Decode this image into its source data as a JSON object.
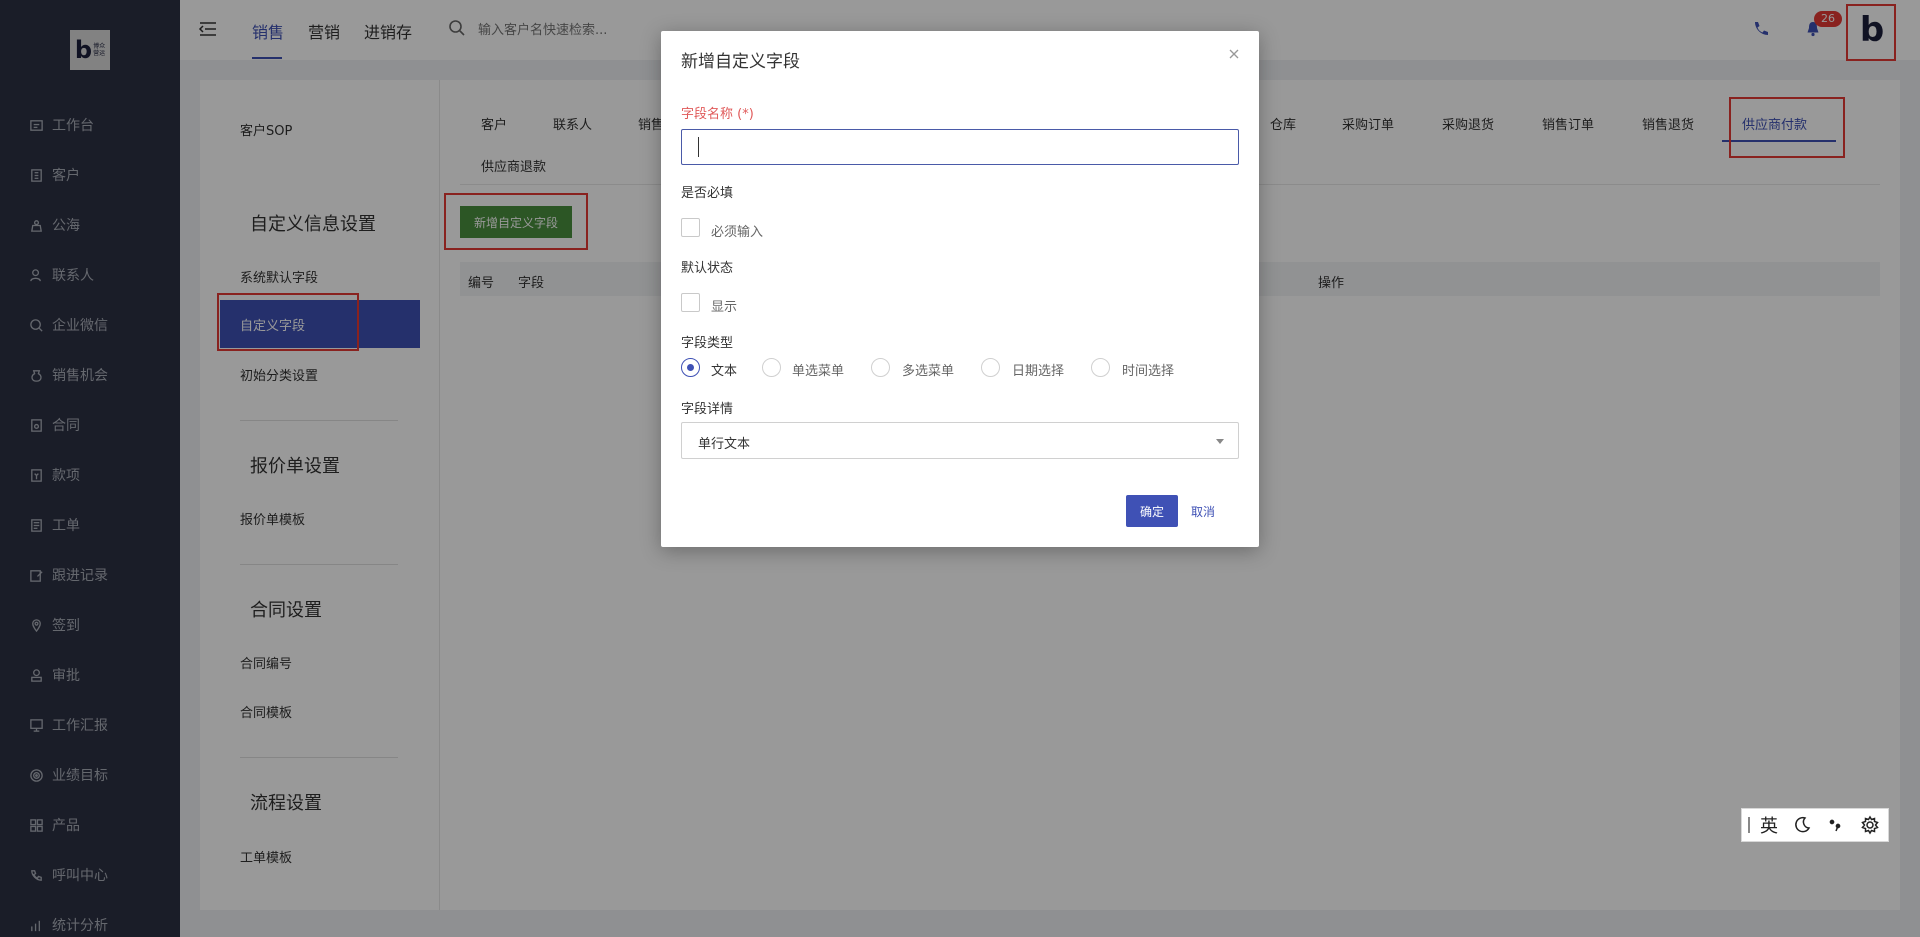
{
  "logo": {
    "letter": "b",
    "sub": "博众 营运"
  },
  "sidebar": {
    "items": [
      {
        "label": "工作台",
        "icon": "dashboard-icon"
      },
      {
        "label": "客户",
        "icon": "building-icon"
      },
      {
        "label": "公海",
        "icon": "sea-icon"
      },
      {
        "label": "联系人",
        "icon": "contact-icon"
      },
      {
        "label": "企业微信",
        "icon": "wechat-icon"
      },
      {
        "label": "销售机会",
        "icon": "money-bag-icon"
      },
      {
        "label": "合同",
        "icon": "contract-icon"
      },
      {
        "label": "款项",
        "icon": "payment-icon"
      },
      {
        "label": "工单",
        "icon": "ticket-icon"
      },
      {
        "label": "跟进记录",
        "icon": "edit-icon"
      },
      {
        "label": "签到",
        "icon": "location-icon"
      },
      {
        "label": "审批",
        "icon": "approval-icon"
      },
      {
        "label": "工作汇报",
        "icon": "report-icon"
      },
      {
        "label": "业绩目标",
        "icon": "target-icon"
      },
      {
        "label": "产品",
        "icon": "product-icon"
      },
      {
        "label": "呼叫中心",
        "icon": "phone-icon"
      },
      {
        "label": "统计分析",
        "icon": "chart-icon"
      }
    ]
  },
  "header": {
    "tabs": [
      {
        "label": "销售",
        "active": true
      },
      {
        "label": "营销",
        "active": false
      },
      {
        "label": "进销存",
        "active": false
      }
    ],
    "search_placeholder": "输入客户名快速检索...",
    "notification_count": "26",
    "avatar_letter": "b"
  },
  "settings_menu": {
    "top_link": "客户SOP",
    "sections": [
      {
        "heading": "自定义信息设置",
        "links": [
          "系统默认字段",
          "自定义字段",
          "初始分类设置"
        ]
      },
      {
        "heading": "报价单设置",
        "links": [
          "报价单模板"
        ]
      },
      {
        "heading": "合同设置",
        "links": [
          "合同编号",
          "合同模板"
        ]
      },
      {
        "heading": "流程设置",
        "links": [
          "工单模板"
        ]
      }
    ]
  },
  "object_tabs": {
    "row1": [
      "客户",
      "联系人",
      "销售",
      "仓库",
      "采购订单",
      "采购退货",
      "销售订单",
      "销售退货",
      "供应商付款"
    ],
    "row2": [
      "供应商退款"
    ],
    "active": "供应商付款"
  },
  "add_button_label": "新增自定义字段",
  "table": {
    "headers": [
      "编号",
      "字段",
      "操作"
    ]
  },
  "modal": {
    "title": "新增自定义字段",
    "field_name_label": "字段名称 (*)",
    "field_name_value": "",
    "required_label": "是否必填",
    "required_checkbox_label": "必须输入",
    "default_state_label": "默认状态",
    "default_state_checkbox_label": "显示",
    "field_type_label": "字段类型",
    "field_types": [
      "文本",
      "单选菜单",
      "多选菜单",
      "日期选择",
      "时间选择"
    ],
    "selected_type": "文本",
    "field_detail_label": "字段详情",
    "field_detail_value": "单行文本",
    "ok_label": "确定",
    "cancel_label": "取消"
  },
  "ime": {
    "lang": "英"
  },
  "colors": {
    "primary": "#3f51b5",
    "sidebar_bg": "#2c3143",
    "add_button": "#4a8f3f",
    "highlight_red": "#e53935",
    "required_red": "#e05a5a"
  }
}
